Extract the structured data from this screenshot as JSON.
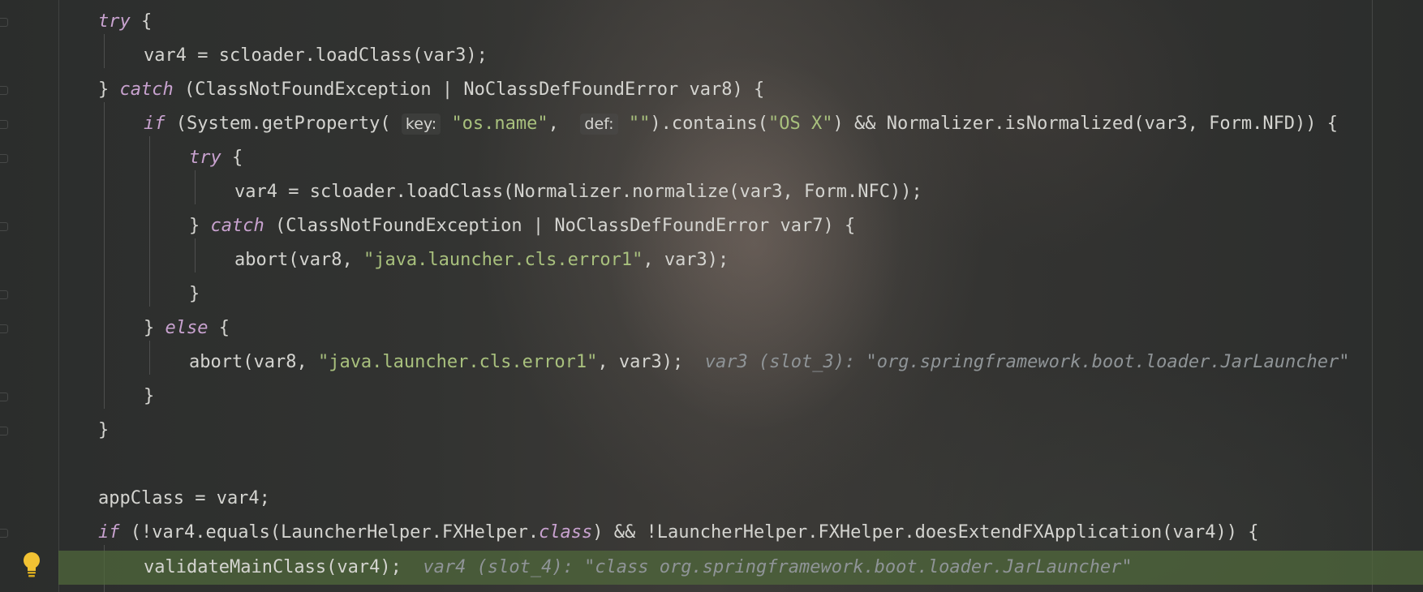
{
  "gutter": {
    "breakpoint_hint": "lightbulb-icon"
  },
  "colors": {
    "keyword": "#c8a2cf",
    "string": "#a8c07d",
    "identifier": "#d4d4d0",
    "inline_debug": "#8f9497",
    "execution_line": "#506a3c"
  },
  "code": {
    "lines": [
      {
        "t1": "try",
        "t2": " {"
      },
      {
        "t1": "var4 = scloader.loadClass(var3);"
      },
      {
        "t1": "} ",
        "t2": "catch",
        "t3": " (ClassNotFoundException | NoClassDefFoundError var8) {"
      },
      {
        "t1": "if",
        "t2": " (System.getProperty( ",
        "hint1": "key:",
        "t3": " ",
        "s1": "\"os.name\"",
        "t4": ",  ",
        "hint2": "def:",
        "t5": " ",
        "s2": "\"\"",
        "t6": ").contains(",
        "s3": "\"OS X\"",
        "t7": ") && Normalizer.isNormalized(var3, Form.NFD)) {"
      },
      {
        "t1": "try",
        "t2": " {"
      },
      {
        "t1": "var4 = scloader.loadClass(Normalizer.normalize(var3, Form.NFC));"
      },
      {
        "t1": "} ",
        "t2": "catch",
        "t3": " (ClassNotFoundException | NoClassDefFoundError var7) {"
      },
      {
        "t1": "abort(var8, ",
        "s1": "\"java.launcher.cls.error1\"",
        "t2": ", var3);"
      },
      {
        "t1": "}"
      },
      {
        "t1": "} ",
        "t2": "else",
        "t3": " {"
      },
      {
        "t1": "abort(var8, ",
        "s1": "\"java.launcher.cls.error1\"",
        "t2": ", var3);",
        "dbg": "var3 (slot_3): \"org.springframework.boot.loader.JarLauncher\""
      },
      {
        "t1": "}"
      },
      {
        "t1": "}"
      },
      {
        "t1": "appClass = var4;"
      },
      {
        "t1": "if",
        "t2": " (!var4.equals(LauncherHelper.FXHelper.",
        "t3": "class",
        "t4": ") && !LauncherHelper.FXHelper.doesExtendFXApplication(var4)) {"
      },
      {
        "t1": "validateMainClass(var4);",
        "dbg": "var4 (slot_4): \"class org.springframework.boot.loader.JarLauncher\""
      }
    ]
  }
}
